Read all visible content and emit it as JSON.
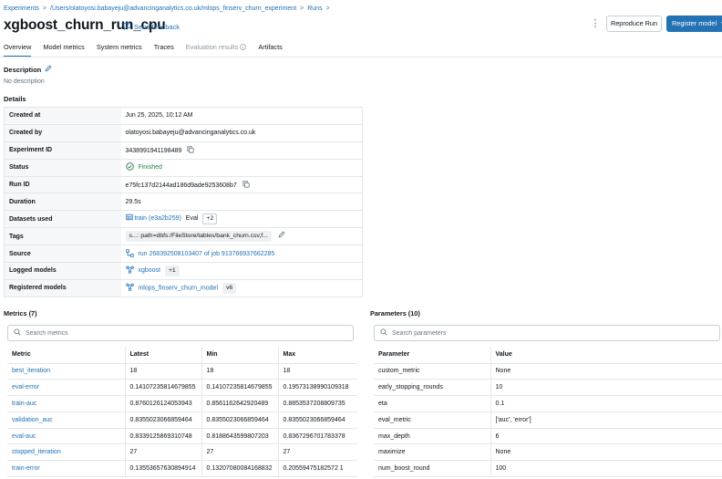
{
  "breadcrumb": {
    "items": [
      "Experiments",
      "/Users/olatoyosi.babayeju@advancinganalytics.co.uk/mlops_finserv_churn_experiment",
      "Runs"
    ],
    "separator": ">"
  },
  "header": {
    "title": "xgboost_churn_run_cpu",
    "feedback": "Send feedback",
    "reproduce_button": "Reproduce Run",
    "register_button": "Register model"
  },
  "tabs": [
    {
      "label": "Overview",
      "state": "active"
    },
    {
      "label": "Model metrics",
      "state": "normal"
    },
    {
      "label": "System metrics",
      "state": "normal"
    },
    {
      "label": "Traces",
      "state": "normal"
    },
    {
      "label": "Evaluation results",
      "state": "disabled"
    },
    {
      "label": "Artifacts",
      "state": "normal"
    }
  ],
  "description": {
    "heading": "Description",
    "text": "No description"
  },
  "details": {
    "heading": "Details",
    "created_at": {
      "label": "Created at",
      "value": "Jun 25, 2025, 10:12 AM"
    },
    "created_by": {
      "label": "Created by",
      "value": "olatoyosi.babayeju@advancinganalytics.co.uk"
    },
    "experiment_id": {
      "label": "Experiment ID",
      "value": "3438991941198489"
    },
    "status": {
      "label": "Status",
      "value": "Finished"
    },
    "run_id": {
      "label": "Run ID",
      "value": "e75fc137d2144ad186d9ade9253608b7"
    },
    "duration": {
      "label": "Duration",
      "value": "29.5s"
    },
    "datasets": {
      "label": "Datasets used",
      "name": "train (e3a2b259)",
      "context": "Eval",
      "more": "+2"
    },
    "tags": {
      "label": "Tags",
      "chip1": "s...",
      "chip2": ": path=dbfs:/FileStore/tables/bank_churn.csv,f..."
    },
    "source": {
      "label": "Source",
      "value": "run 268392508103407 of job 913766937662285"
    },
    "logged_models": {
      "label": "Logged models",
      "value": "xgboost",
      "more": "+1"
    },
    "registered_models": {
      "label": "Registered models",
      "value": "mlops_finserv_churn_model",
      "version": "v6"
    }
  },
  "metrics": {
    "heading": "Metrics (7)",
    "search_placeholder": "Search metrics",
    "columns": [
      "Metric",
      "Latest",
      "Min",
      "Max"
    ],
    "rows": [
      [
        "best_iteration",
        "18",
        "18",
        "18"
      ],
      [
        "eval-error",
        "0.14107235814679855",
        "0.14107235814679855",
        "0.19573138990109318"
      ],
      [
        "train-auc",
        "0.8760126124053943",
        "0.8561162642920489",
        "0.8853537208809735"
      ],
      [
        "validation_auc",
        "0.8355023066859464",
        "0.8355023066859464",
        "0.8355023066859464"
      ],
      [
        "eval-auc",
        "0.8339125869310748",
        "0.8188643599807203",
        "0.8367296701783378"
      ],
      [
        "stopped_iteration",
        "27",
        "27",
        "27"
      ],
      [
        "train-error",
        "0.13553657630894914",
        "0.13207080084168832",
        "0.20559475182572 1"
      ]
    ]
  },
  "parameters": {
    "heading": "Parameters (10)",
    "search_placeholder": "Search parameters",
    "columns": [
      "Parameter",
      "Value"
    ],
    "rows": [
      [
        "custom_metric",
        "None"
      ],
      [
        "early_stopping_rounds",
        "10"
      ],
      [
        "eta",
        "0.1"
      ],
      [
        "eval_metric",
        "['auc', 'error']"
      ],
      [
        "max_depth",
        "6"
      ],
      [
        "maximize",
        "None"
      ],
      [
        "num_boost_round",
        "100"
      ]
    ]
  },
  "colors": {
    "accent": "#2272b4",
    "success": "#277c43",
    "label_bg": "#f5f7f8"
  }
}
